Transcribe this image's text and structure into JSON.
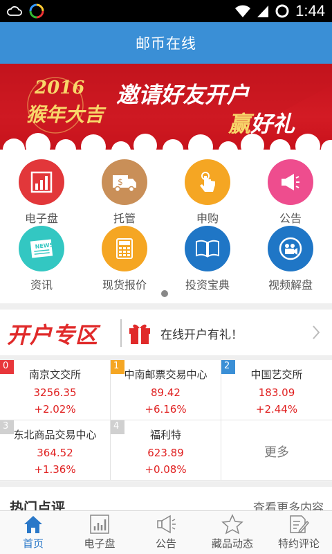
{
  "statusbar": {
    "time": "1:44"
  },
  "header": {
    "title": "邮币在线"
  },
  "banner": {
    "year_text": "2016",
    "fortune_text": "猴年大吉",
    "headline_1": "邀请好友开户",
    "headline_2_accent": "赢",
    "headline_2_rest": "好礼"
  },
  "shortcuts": [
    {
      "label": "电子盘",
      "color": "#e2373a",
      "icon": "bar-chart-icon"
    },
    {
      "label": "托管",
      "color": "#c98f58",
      "icon": "truck-icon"
    },
    {
      "label": "申购",
      "color": "#f5a623",
      "icon": "tap-hand-icon"
    },
    {
      "label": "公告",
      "color": "#ee4d8e",
      "icon": "megaphone-icon"
    },
    {
      "label": "资讯",
      "color": "#33c7c2",
      "icon": "newspaper-icon"
    },
    {
      "label": "现货报价",
      "color": "#f5a623",
      "icon": "calculator-icon"
    },
    {
      "label": "投资宝典",
      "color": "#1f76c6",
      "icon": "book-icon"
    },
    {
      "label": "视频解盘",
      "color": "#1f76c6",
      "icon": "video-camera-icon"
    }
  ],
  "open_account": {
    "logo_text": "开户专区",
    "promo_text": "在线开户有礼！"
  },
  "exchanges": [
    {
      "rank": "0",
      "rank_color": "#e8363a",
      "name": "南京文交所",
      "price": "3256.35",
      "change": "+2.02%"
    },
    {
      "rank": "1",
      "rank_color": "#f5a623",
      "name": "中南邮票交易中心",
      "price": "89.42",
      "change": "+6.16%"
    },
    {
      "rank": "2",
      "rank_color": "#3a8fd6",
      "name": "中国艺交所",
      "price": "183.09",
      "change": "+2.44%"
    },
    {
      "rank": "3",
      "rank_color": "#d0d0d0",
      "name": "东北商品交易中心",
      "price": "364.52",
      "change": "+1.36%"
    },
    {
      "rank": "4",
      "rank_color": "#d0d0d0",
      "name": "福利特",
      "price": "623.89",
      "change": "+0.08%"
    }
  ],
  "more_label": "更多",
  "hot_section": {
    "title": "热门点评",
    "more": "查看更多内容"
  },
  "tabs": [
    {
      "label": "首页",
      "icon": "home-icon",
      "active": true
    },
    {
      "label": "电子盘",
      "icon": "bar-chart-icon",
      "active": false
    },
    {
      "label": "公告",
      "icon": "megaphone-icon",
      "active": false
    },
    {
      "label": "藏品动态",
      "icon": "star-icon",
      "active": false
    },
    {
      "label": "特约评论",
      "icon": "edit-icon",
      "active": false
    }
  ],
  "colors": {
    "primary": "#3a8fd6",
    "up": "#e02020",
    "banner_red": "#d31b24"
  }
}
